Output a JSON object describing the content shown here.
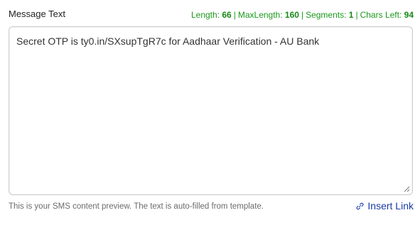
{
  "field": {
    "label": "Message Text",
    "value": "Secret OTP is ty0.in/SXsupTgR7c for Aadhaar Verification - AU Bank"
  },
  "stats": {
    "length_label": "Length:",
    "length_value": "66",
    "max_label": "MaxLength:",
    "max_value": "160",
    "segments_label": "Segments:",
    "segments_value": "1",
    "chars_left_label": "Chars Left:",
    "chars_left_value": "94",
    "separator": "|"
  },
  "footer": {
    "hint": "This is your SMS content preview. The text is auto-filled from template.",
    "insert_link_label": "Insert Link",
    "insert_link_icon": "link-icon"
  },
  "colors": {
    "stats_green": "#1a9a1a",
    "link_blue": "#1a3aa8"
  }
}
